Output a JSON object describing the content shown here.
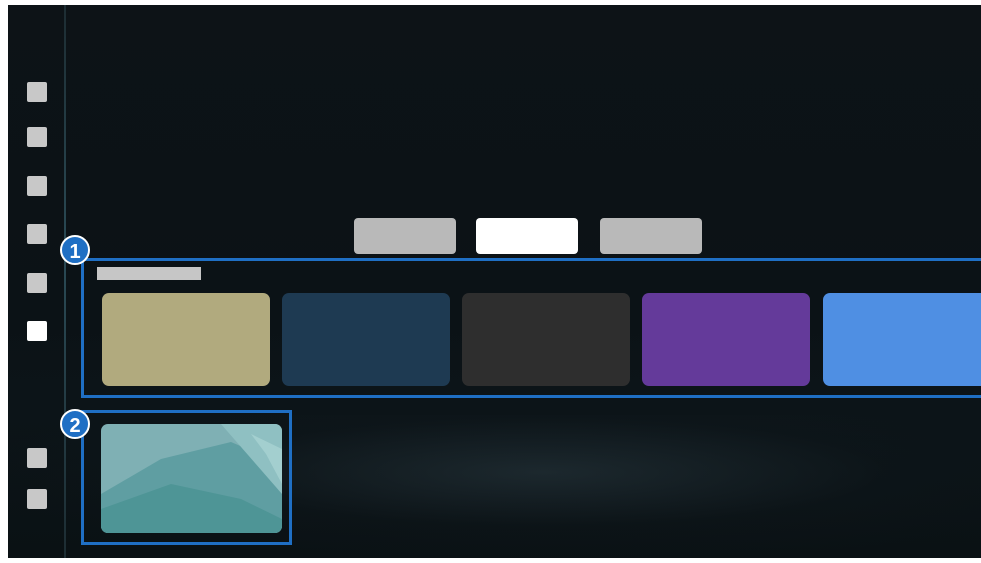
{
  "sidebar": {
    "items": [
      {
        "icon": "menu-item-icon",
        "active": false
      },
      {
        "icon": "menu-item-icon",
        "active": false
      },
      {
        "icon": "menu-item-icon",
        "active": false
      },
      {
        "icon": "menu-item-icon",
        "active": false
      },
      {
        "icon": "menu-item-icon",
        "active": false
      },
      {
        "icon": "menu-item-icon",
        "active": true
      },
      {
        "icon": "menu-item-icon",
        "active": false
      },
      {
        "icon": "menu-item-icon",
        "active": false
      }
    ]
  },
  "tabs": [
    {
      "selected": false
    },
    {
      "selected": true
    },
    {
      "selected": false
    }
  ],
  "callouts": {
    "first": "1",
    "second": "2"
  },
  "content_row": {
    "tile_colors": [
      "#b1aa7e",
      "#1e3a52",
      "#2e2e2e",
      "#643a9a",
      "#4f8fe3"
    ]
  },
  "colors": {
    "highlight": "#1f6fc4",
    "background": "#0d1317"
  }
}
